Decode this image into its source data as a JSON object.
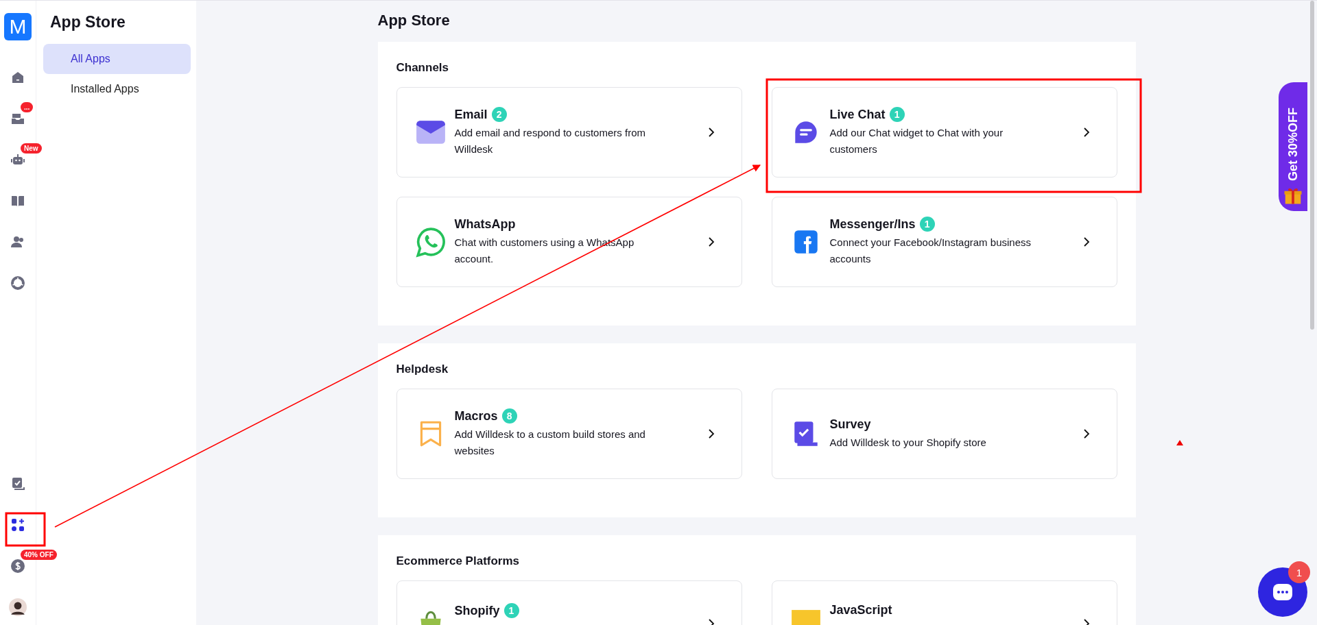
{
  "rail": {
    "logo": "M",
    "items": [
      {
        "kind": "home",
        "selected": false
      },
      {
        "kind": "inbox",
        "selected": false,
        "badge": "..."
      },
      {
        "kind": "bot",
        "selected": false,
        "badge": "New"
      },
      {
        "kind": "book",
        "selected": false
      },
      {
        "kind": "contacts",
        "selected": false
      },
      {
        "kind": "reports",
        "selected": false
      }
    ],
    "bottom_items": [
      {
        "kind": "tasks",
        "selected": false
      },
      {
        "kind": "apps",
        "selected": true
      },
      {
        "kind": "billing",
        "selected": false,
        "badge": "40% OFF"
      },
      {
        "kind": "avatar"
      }
    ]
  },
  "sidebar": {
    "title": "App Store",
    "items": [
      {
        "label": "All Apps",
        "selected": true
      },
      {
        "label": "Installed Apps",
        "selected": false
      }
    ]
  },
  "page_title": "App Store",
  "sections": [
    {
      "title": "Channels",
      "cards": [
        {
          "kind": "email",
          "name": "Email",
          "count": "2",
          "description": "Add email and respond to customers from Willdesk"
        },
        {
          "kind": "livechat",
          "name": "Live Chat",
          "count": "1",
          "description": "Add our Chat widget to Chat with your customers"
        },
        {
          "kind": "whatsapp",
          "name": "WhatsApp",
          "description": "Chat with customers using a WhatsApp account."
        },
        {
          "kind": "messenger",
          "name": "Messenger/Ins",
          "count": "1",
          "description": "Connect your Facebook/Instagram business accounts"
        }
      ]
    },
    {
      "title": "Helpdesk",
      "cards": [
        {
          "kind": "macros",
          "name": "Macros",
          "count": "8",
          "description": "Add Willdesk to a custom build stores and websites"
        },
        {
          "kind": "survey",
          "name": "Survey",
          "description": "Add Willdesk to your Shopify store"
        }
      ]
    },
    {
      "title": "Ecommerce Platforms",
      "cards": [
        {
          "kind": "shopify",
          "name": "Shopify",
          "count": "1"
        },
        {
          "kind": "javascript",
          "name": "JavaScript"
        }
      ]
    }
  ],
  "promo_tab": {
    "label": "Get 30%OFF"
  },
  "chat_widget": {
    "badge": "1"
  }
}
